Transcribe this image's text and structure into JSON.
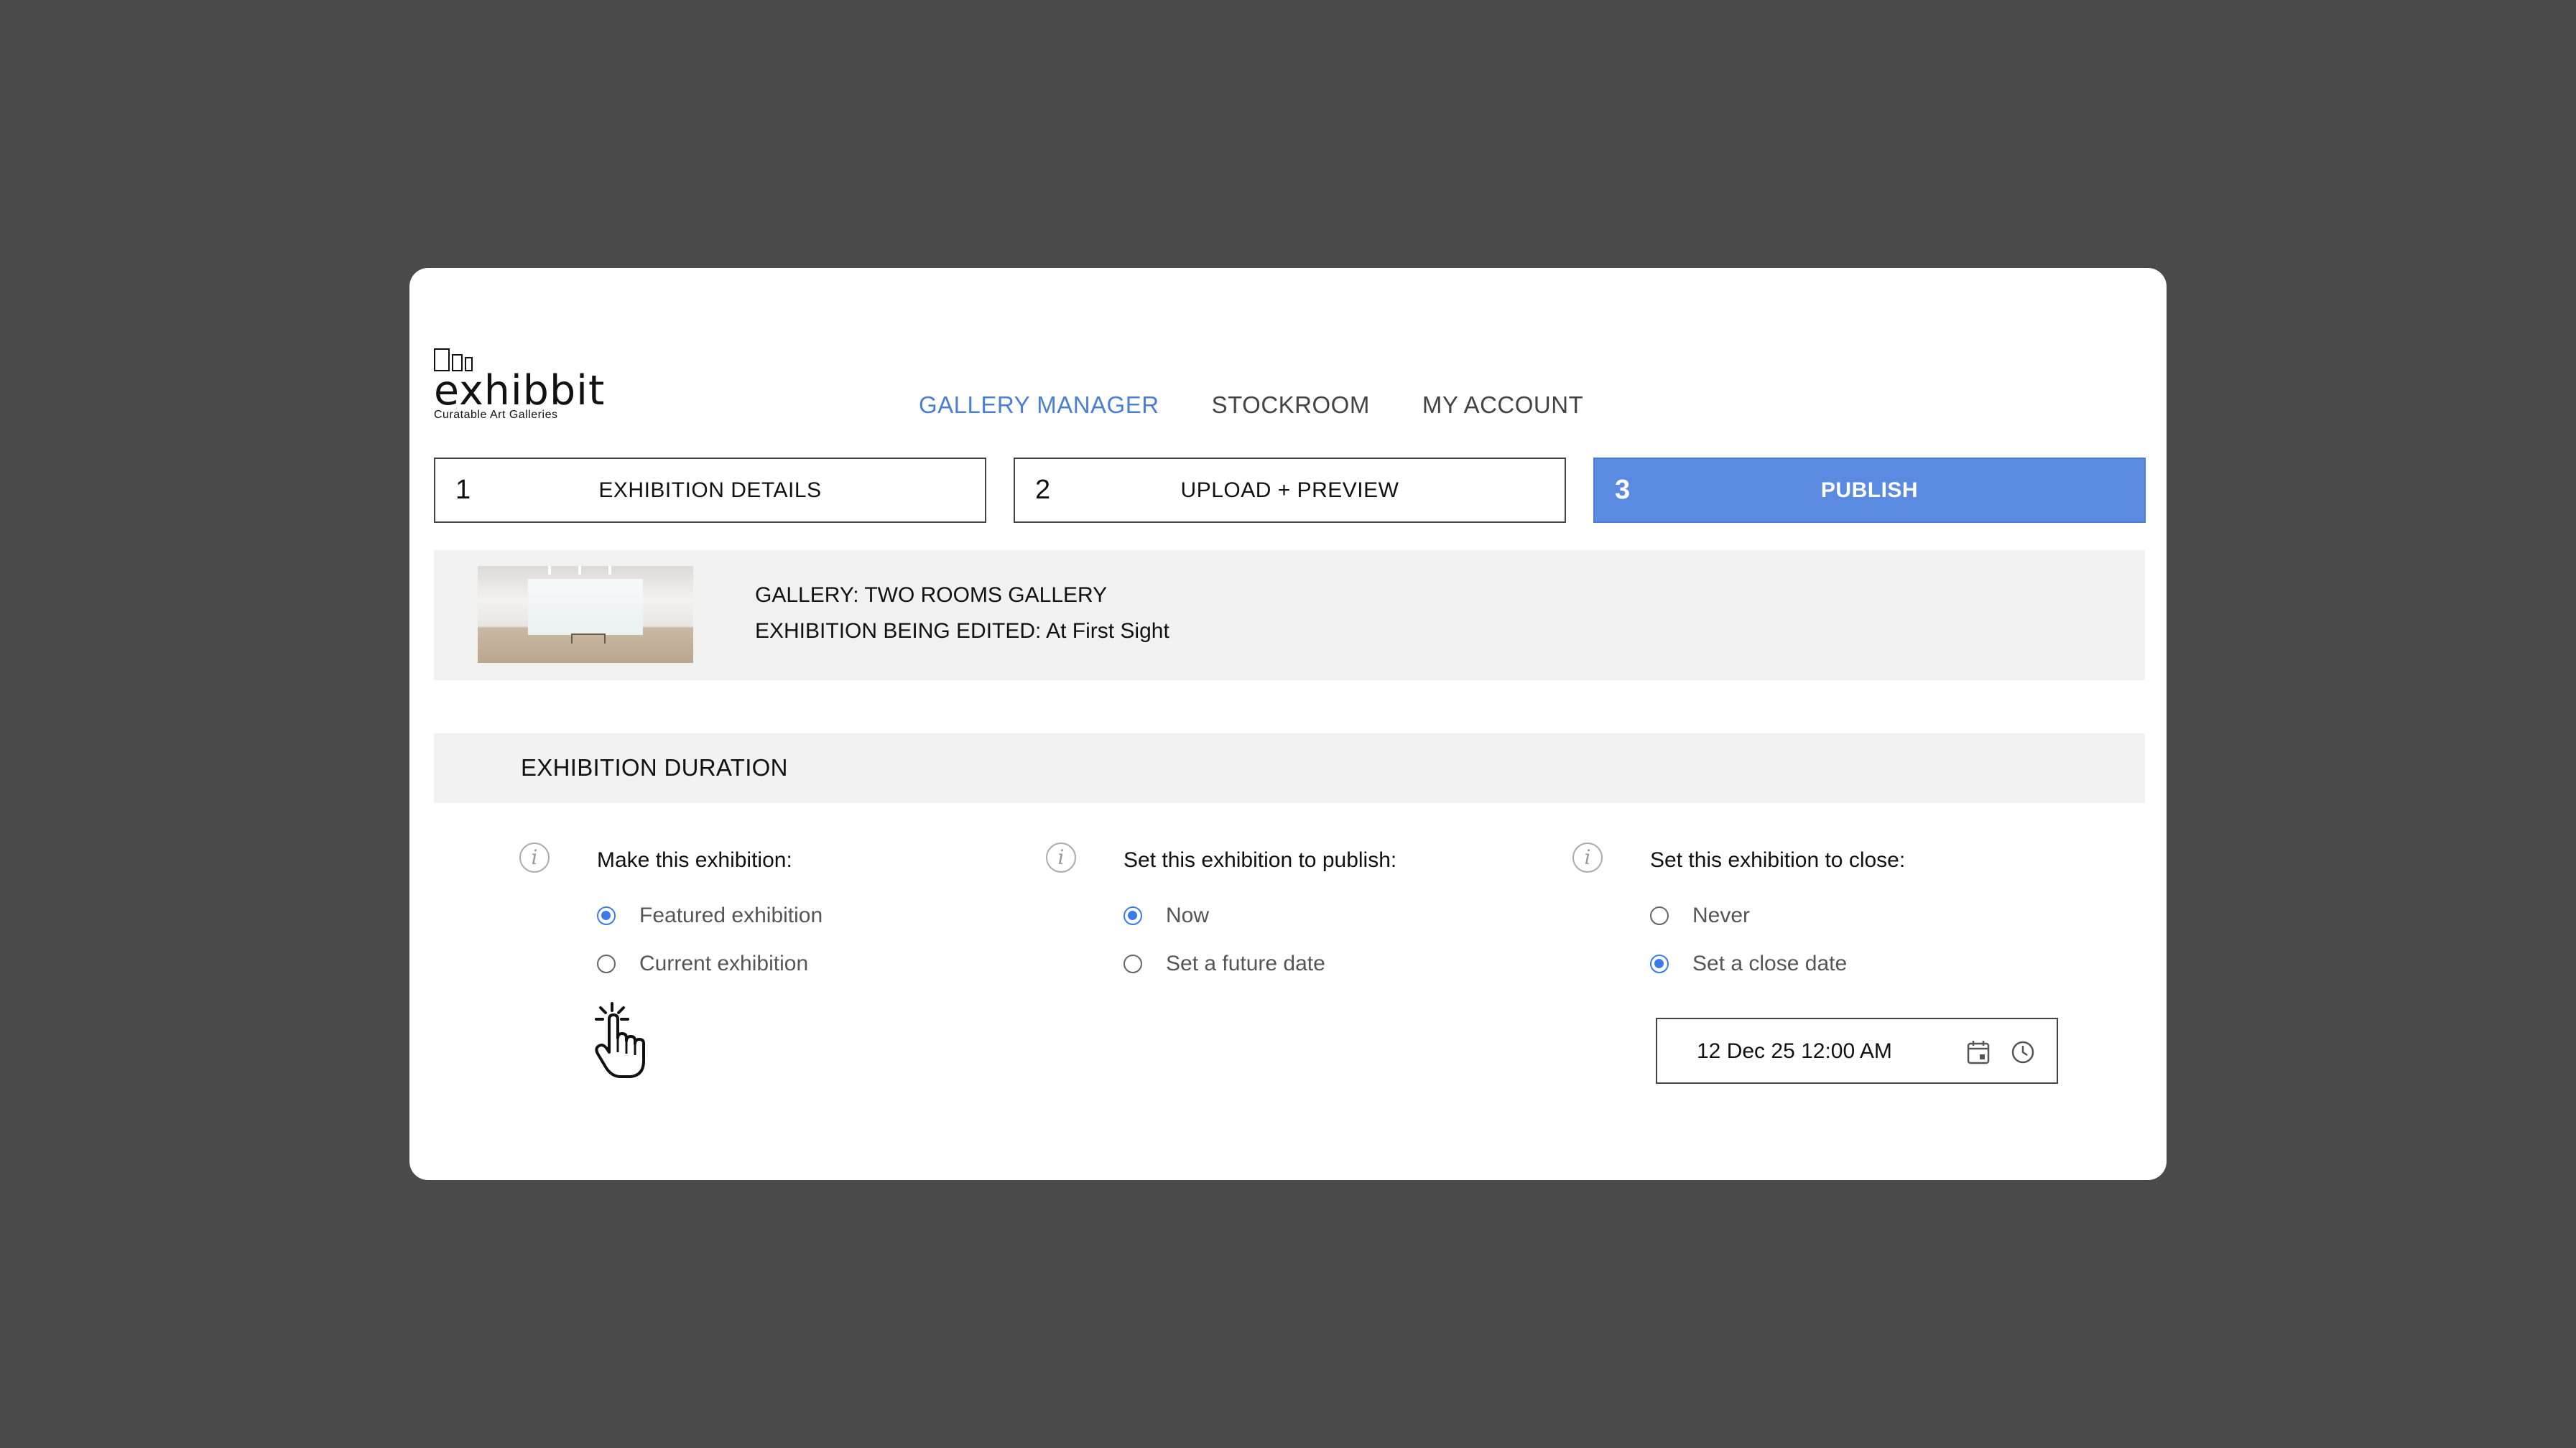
{
  "logo": {
    "name": "exhibbit",
    "tagline": "Curatable Art Galleries"
  },
  "nav": [
    {
      "label": "GALLERY MANAGER",
      "active": true
    },
    {
      "label": "STOCKROOM",
      "active": false
    },
    {
      "label": "MY ACCOUNT",
      "active": false
    }
  ],
  "steps": [
    {
      "num": "1",
      "label": "EXHIBITION DETAILS",
      "active": false
    },
    {
      "num": "2",
      "label": "UPLOAD + PREVIEW",
      "active": false
    },
    {
      "num": "3",
      "label": "PUBLISH",
      "active": true
    }
  ],
  "gallery_info": {
    "gallery_line": "GALLERY: TWO ROOMS GALLERY",
    "exhibition_line": "EXHIBITION BEING EDITED: At First Sight"
  },
  "duration": {
    "title": "EXHIBITION DURATION",
    "info_glyph": "i",
    "columns": [
      {
        "title": "Make this exhibition:",
        "options": [
          {
            "label": "Featured exhibition",
            "selected": true
          },
          {
            "label": "Current exhibition",
            "selected": false
          }
        ]
      },
      {
        "title": "Set this exhibition to publish:",
        "options": [
          {
            "label": "Now",
            "selected": true
          },
          {
            "label": "Set a future date",
            "selected": false
          }
        ]
      },
      {
        "title": "Set this exhibition to close:",
        "options": [
          {
            "label": "Never",
            "selected": false
          },
          {
            "label": "Set a close date",
            "selected": true
          }
        ]
      }
    ],
    "close_date_value": "12 Dec 25 12:00 AM"
  },
  "colors": {
    "accent": "#4a7fd9",
    "step_active_bg": "#5b8be0",
    "radio_on": "#3a7be6",
    "backdrop": "#4a4a4a",
    "panel": "#f1f1f1"
  },
  "icons": [
    "info-icon",
    "calendar-icon",
    "clock-icon",
    "pointer-hand-cursor"
  ]
}
